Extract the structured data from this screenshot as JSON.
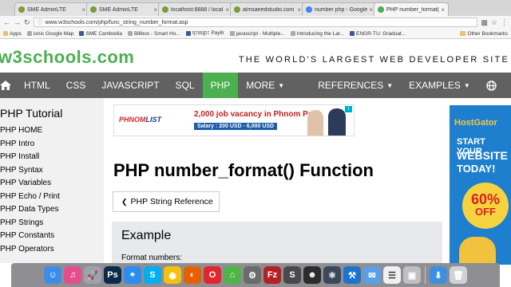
{
  "browser": {
    "tabs": [
      {
        "title": "SME AdminLTE",
        "icon": "sme-favicon"
      },
      {
        "title": "SME AdminLTE",
        "icon": "sme-favicon"
      },
      {
        "title": "localhost:8888 / local",
        "icon": "sme-favicon"
      },
      {
        "title": "almsaeedstudio.com",
        "icon": "sme-favicon"
      },
      {
        "title": "number php - Google",
        "icon": "google-favicon"
      },
      {
        "title": "PHP number_format() ",
        "icon": "w3-favicon",
        "active": true
      }
    ],
    "url": "www.w3schools.com/php/func_string_number_format.asp",
    "bookmarks": [
      {
        "label": "Apps",
        "icon": "apps-icon"
      },
      {
        "label": "ionic Google Map",
        "icon": "file-icon"
      },
      {
        "label": "SME Cambodia",
        "icon": "facebook-icon"
      },
      {
        "label": "Billbox - Smart Ho...",
        "icon": "file-icon"
      },
      {
        "label": "ចុះឈ្មោះ Payllr",
        "icon": "facebook-icon"
      },
      {
        "label": "javascript - Multiple...",
        "icon": "file-icon"
      },
      {
        "label": "Introducing the Lar...",
        "icon": "file-icon"
      },
      {
        "label": "ENGR-TU: Graduat...",
        "icon": "facebook-icon"
      }
    ],
    "other_bookmarks": "Other Bookmarks"
  },
  "site": {
    "logo": "w3schools",
    "logo_tld": ".com",
    "tagline": "THE WORLD'S LARGEST WEB DEVELOPER SITE",
    "nav": [
      {
        "label": "HTML"
      },
      {
        "label": "CSS"
      },
      {
        "label": "JAVASCRIPT"
      },
      {
        "label": "SQL"
      },
      {
        "label": "PHP",
        "active": true
      },
      {
        "label": "MORE",
        "dropdown": true
      },
      {
        "label": "REFERENCES",
        "dropdown": true
      },
      {
        "label": "EXAMPLES",
        "dropdown": true
      }
    ],
    "accent_color": "#4caf50",
    "nav_color": "#616161"
  },
  "sidebar": {
    "title": "PHP Tutorial",
    "items": [
      "PHP HOME",
      "PHP Intro",
      "PHP Install",
      "PHP Syntax",
      "PHP Variables",
      "PHP Echo / Print",
      "PHP Data Types",
      "PHP Strings",
      "PHP Constants",
      "PHP Operators"
    ]
  },
  "main": {
    "ad": {
      "logo_a": "PHNOM",
      "logo_b": "LIST",
      "headline": "2,000 job vacancy in Phnom Penh",
      "salary": "Salary : 200 USD - 6,000 USD"
    },
    "title": "PHP number_format() Function",
    "ref_button": "PHP String Reference",
    "example_title": "Example",
    "example_code": "Format numbers:"
  },
  "right_ad": {
    "brand": "HostGator",
    "line1": "START YOUR",
    "line2": "WEBSITE",
    "line3": "TODAY!",
    "percent": "60%",
    "off": "OFF"
  },
  "dock": {
    "icons": [
      "finder-icon",
      "itunes-icon",
      "launchpad-icon",
      "photoshop-icon",
      "safari-icon",
      "skype-icon",
      "chrome-icon",
      "firefox-icon",
      "opera-icon",
      "maps-icon",
      "settings-icon",
      "filezilla-icon",
      "sublime-icon",
      "alien-icon",
      "atom-icon",
      "xcode-icon",
      "mail-icon",
      "reminders-icon",
      "preview-icon",
      "downloads-icon",
      "trash-icon"
    ]
  }
}
